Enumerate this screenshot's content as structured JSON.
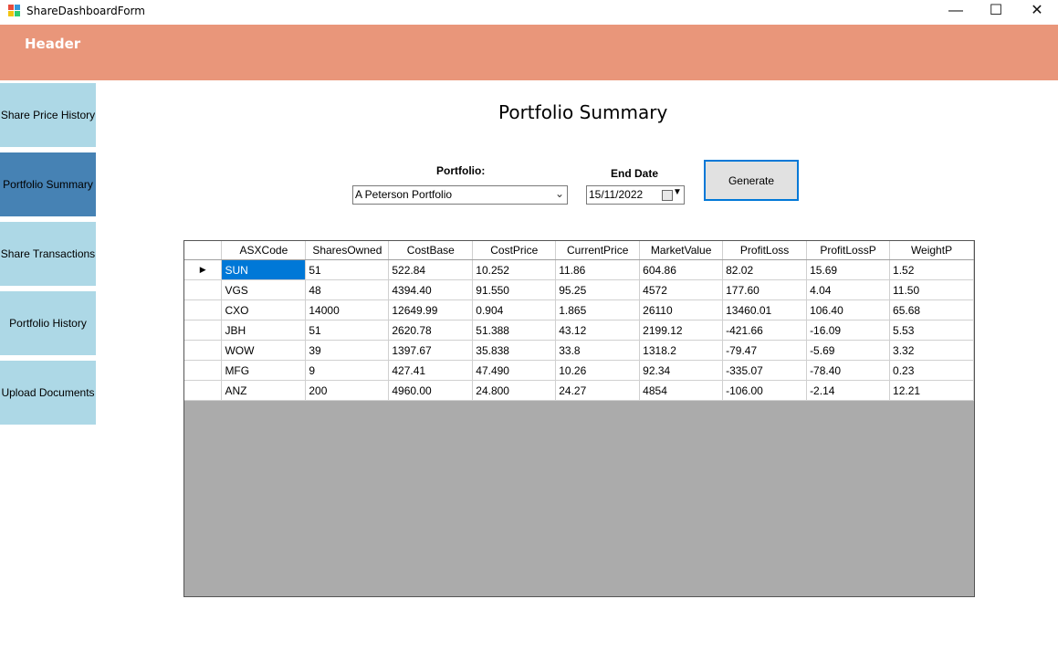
{
  "window": {
    "title": "ShareDashboardForm",
    "min_icon": "minimize-icon",
    "max_icon": "maximize-icon",
    "close_icon": "close-icon"
  },
  "header": {
    "label": "Header",
    "color": "#e9967a"
  },
  "nav": [
    {
      "label": "Share Price History",
      "active": false
    },
    {
      "label": "Portfolio Summary",
      "active": true
    },
    {
      "label": "Share Transactions",
      "active": false
    },
    {
      "label": "Portfolio History",
      "active": false
    },
    {
      "label": "Upload Documents",
      "active": false
    }
  ],
  "colors": {
    "nav_bg": "#add8e6",
    "nav_active_bg": "#4682b4",
    "selection": "#0078d7"
  },
  "main": {
    "title": "Portfolio Summary",
    "portfolio_label": "Portfolio:",
    "portfolio_value": "A Peterson Portfolio",
    "end_date_label": "End Date",
    "end_date_value": "15/11/2022",
    "generate_label": "Generate"
  },
  "grid": {
    "columns": [
      "ASXCode",
      "SharesOwned",
      "CostBase",
      "CostPrice",
      "CurrentPrice",
      "MarketValue",
      "ProfitLoss",
      "ProfitLossP",
      "WeightP"
    ],
    "rows": [
      [
        "SUN",
        "51",
        "522.84",
        "10.252",
        "11.86",
        "604.86",
        "82.02",
        "15.69",
        "1.52"
      ],
      [
        "VGS",
        "48",
        "4394.40",
        "91.550",
        "95.25",
        "4572",
        "177.60",
        "4.04",
        "11.50"
      ],
      [
        "CXO",
        "14000",
        "12649.99",
        "0.904",
        "1.865",
        "26110",
        "13460.01",
        "106.40",
        "65.68"
      ],
      [
        "JBH",
        "51",
        "2620.78",
        "51.388",
        "43.12",
        "2199.12",
        "-421.66",
        "-16.09",
        "5.53"
      ],
      [
        "WOW",
        "39",
        "1397.67",
        "35.838",
        "33.8",
        "1318.2",
        "-79.47",
        "-5.69",
        "3.32"
      ],
      [
        "MFG",
        "9",
        "427.41",
        "47.490",
        "10.26",
        "92.34",
        "-335.07",
        "-78.40",
        "0.23"
      ],
      [
        "ANZ",
        "200",
        "4960.00",
        "24.800",
        "24.27",
        "4854",
        "-106.00",
        "-2.14",
        "12.21"
      ]
    ],
    "current_row_marker": "▶"
  }
}
